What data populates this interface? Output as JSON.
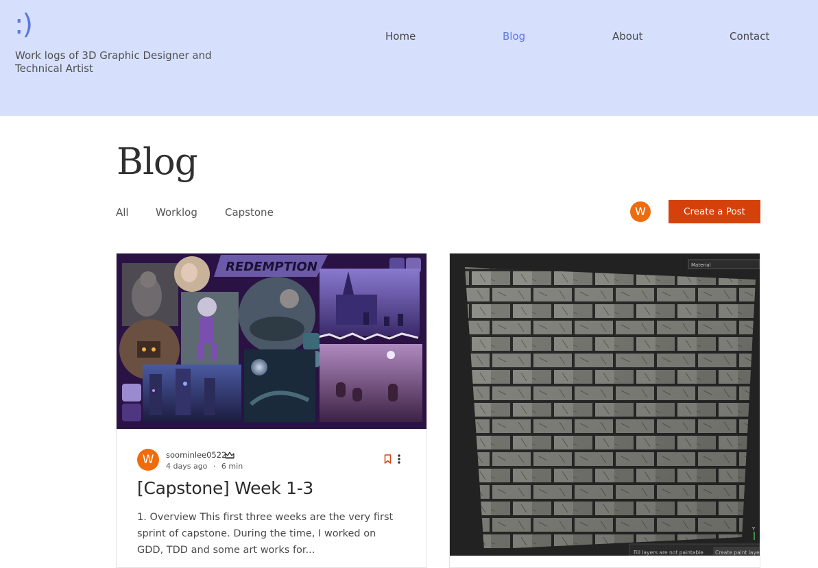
{
  "header": {
    "logo": ":)",
    "tagline": "Work logs of 3D Graphic Designer and Technical Artist",
    "nav": [
      {
        "label": "Home",
        "active": false
      },
      {
        "label": "Blog",
        "active": true
      },
      {
        "label": "About",
        "active": false
      },
      {
        "label": "Contact",
        "active": false
      }
    ],
    "bg_color": "#d6e0fd",
    "accent": "#5b77e0"
  },
  "main": {
    "title": "Blog",
    "categories": [
      "All",
      "Worklog",
      "Capstone"
    ],
    "user_initial": "W",
    "create_post_label": "Create a Post",
    "button_color": "#d5410b"
  },
  "posts": [
    {
      "cover_title": "REDEMPTION",
      "author_initial": "W",
      "author": "soominlee0522",
      "time_ago": "4 days ago",
      "separator": "·",
      "read_time": "6 min",
      "title": "[Capstone] Week 1-3",
      "excerpt": "1. Overview This first three weeks are the very first sprint of capstone. During the time, I worked on GDD, TDD and some art works for..."
    },
    {
      "material_label": "Material",
      "status_left": "Fill layers are not paintable",
      "status_right": "Create paint layer",
      "axis_label": "Y"
    }
  ]
}
